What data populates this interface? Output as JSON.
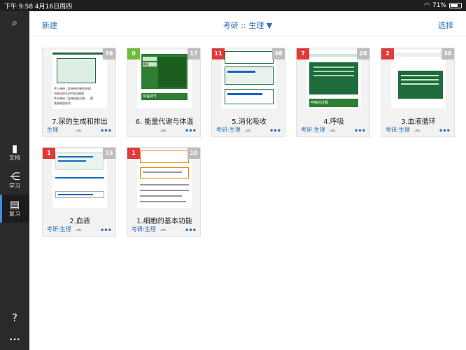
{
  "status": {
    "time_date": "下午 9:58  4月16日周四",
    "battery": "71%",
    "battery_level": 0.71
  },
  "sidebar": {
    "search_icon": "search-icon",
    "items": [
      {
        "label": "文档",
        "icon": "document-icon"
      },
      {
        "label": "学习",
        "icon": "share-nodes-icon"
      },
      {
        "label": "复习",
        "icon": "clipboard-icon"
      }
    ],
    "help": "?",
    "more": "•••"
  },
  "topbar": {
    "new": "新建",
    "title": "考研 :: 生理 ▼",
    "select": "选择"
  },
  "cards": [
    {
      "title": "7.尿的生成和排出",
      "tag": "生理",
      "badge": "23",
      "badge_color": "red",
      "count": "38"
    },
    {
      "title": "6. 能量代谢与体温",
      "tag": "",
      "badge": "0",
      "badge_color": "green",
      "count": "17"
    },
    {
      "title": "5.消化吸收",
      "tag": "考研:生理",
      "badge": "11",
      "badge_color": "red",
      "count": "38"
    },
    {
      "title": "4.呼吸",
      "tag": "考研:生理",
      "badge": "7",
      "badge_color": "red",
      "count": "28"
    },
    {
      "title": "3.血液循环",
      "tag": "考研:生理",
      "badge": "2",
      "badge_color": "red",
      "count": "38"
    },
    {
      "title": "2.血液",
      "tag": "考研:生理",
      "badge": "1",
      "badge_color": "red",
      "count": "15"
    },
    {
      "title": "1.细胞的基本功能",
      "tag": "考研:生理",
      "badge": "1",
      "badge_color": "red",
      "count": "10"
    }
  ],
  "thumb_text": {
    "c0_lines": [
      "传入神经（盆神经的感觉纤维）",
      "初级排尿反射中枢(骶髓)",
      "传出神经（盆神经副交感）、膀",
      "胱收缩逼尿肌"
    ],
    "c1_rows": [
      "体温",
      "体温调节"
    ],
    "c3_title": "呼吸的过程"
  }
}
